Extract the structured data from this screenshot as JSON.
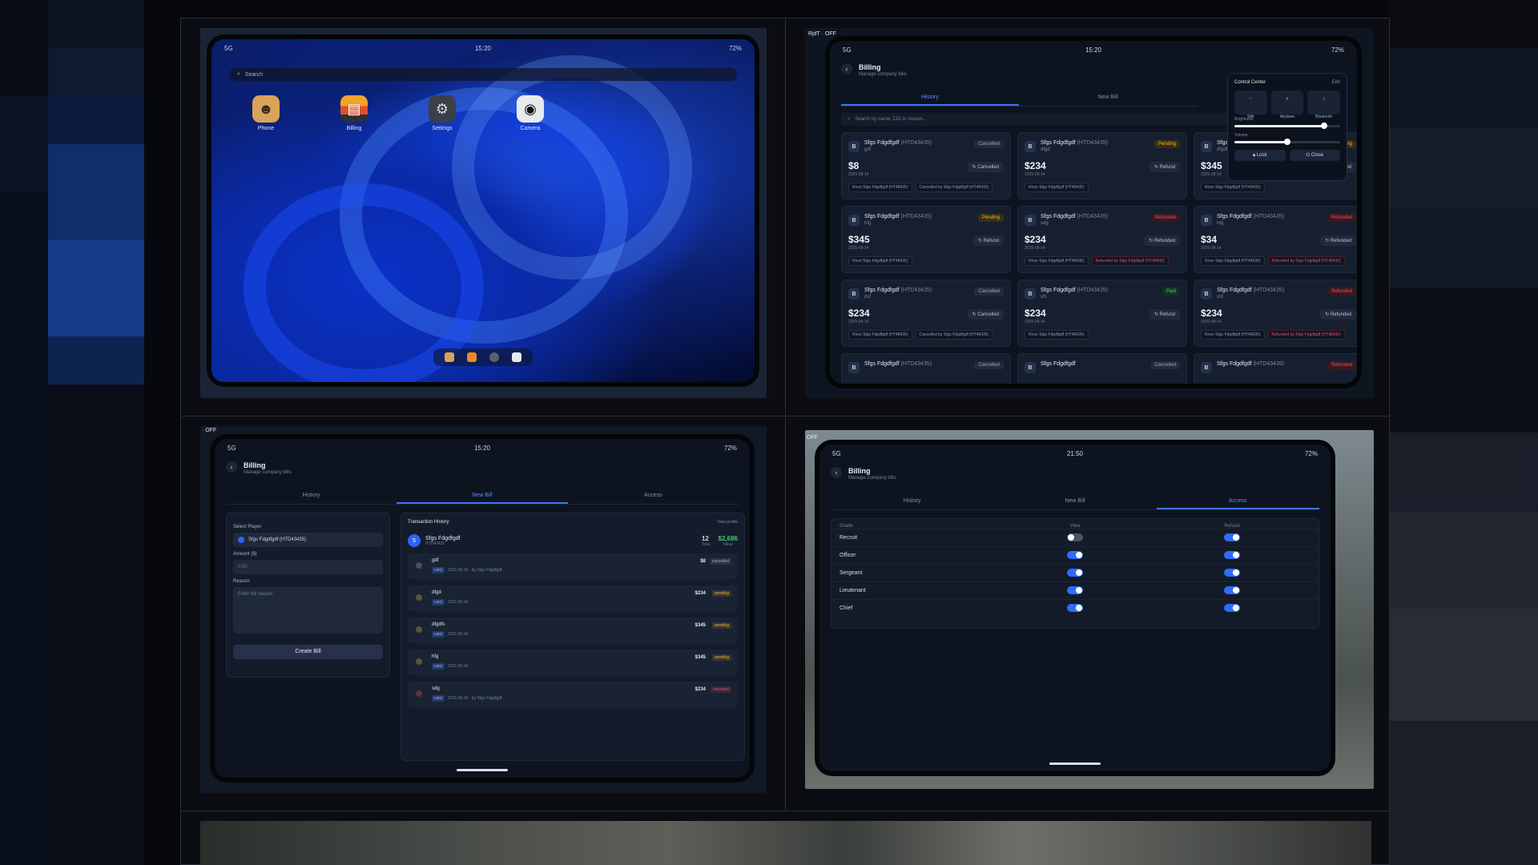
{
  "panel1": {
    "status": {
      "left": "5G",
      "time": "15:20",
      "right": "72%"
    },
    "search_placeholder": "Search",
    "apps": [
      {
        "label": "Phone",
        "icon": "person-icon"
      },
      {
        "label": "Billing",
        "icon": "wallet-icon"
      },
      {
        "label": "Settings",
        "icon": "gear-icon"
      },
      {
        "label": "Camera",
        "icon": "camera-icon"
      }
    ]
  },
  "panel2": {
    "corner_label": "RjdT · OFF",
    "status": {
      "left": "5G",
      "time": "15:20",
      "right": "72%"
    },
    "title": "Billing",
    "subtitle": "Manage company bills",
    "tabs": [
      "History",
      "New Bill"
    ],
    "search_placeholder": "Search by name, CID or reason...",
    "control_center": {
      "title": "Control Center",
      "edit": "Edit",
      "toggles": [
        "Wifi",
        "Airplane",
        "Bluetooth"
      ],
      "brightness_label": "Brightness",
      "brightness": 0.85,
      "volume_label": "Volume",
      "volume": 0.5,
      "lock": "Lock",
      "close": "Close"
    },
    "cards": [
      {
        "name": "Sfgs Fdgdfgdf",
        "cid": "(HTD43435)",
        "reason": "gdf",
        "status": "Cancelled",
        "st": "c",
        "amount": "$8",
        "date": "2025-08-14",
        "action": "Cancelled",
        "chips": [
          "Khun Sfgs Fdgdfgdf (HT48435)",
          "Cancelled by Sfgs Fdgdfgdf (HT48435)"
        ]
      },
      {
        "name": "Sfgs Fdgdfgdf",
        "cid": "(HTD43435)",
        "reason": "dfgd",
        "status": "Pending",
        "st": "p",
        "amount": "$234",
        "date": "2025-08-14",
        "action": "Refund",
        "chips": [
          "Khun Sfgs Fdgdfgdf (HT48435)"
        ]
      },
      {
        "name": "Sfgs Fdgdfgdf",
        "cid": "(HTD43435)",
        "reason": "dfgdfs",
        "status": "Pending",
        "st": "p",
        "amount": "$345",
        "date": "2025-08-14",
        "action": "Refund",
        "chips": [
          "Khun Sfgs Fdgdfgdf (HT48435)"
        ]
      },
      {
        "name": "Sfgs Fdgdfgdf",
        "cid": "(HTD43435)",
        "reason": "hfg",
        "status": "Pending",
        "st": "p",
        "amount": "$345",
        "date": "2025-08-14",
        "action": "Refund",
        "chips": [
          "Khun Sfgs Fdgdfgdf (HT48435)"
        ]
      },
      {
        "name": "Sfgs Fdgdfgdf",
        "cid": "(HTD43435)",
        "reason": "sdg",
        "status": "Refunded",
        "st": "r",
        "amount": "$234",
        "date": "2025-08-14",
        "action": "Refunded",
        "chips": [
          "Khun Sfgs Fdgdfgdf (HT48435)",
          "Refunded by Sfgs Fdgdfgdf (HT48435)"
        ]
      },
      {
        "name": "Sfgs Fdgdfgdf",
        "cid": "(HTD43435)",
        "reason": "hfg",
        "status": "Refunded",
        "st": "r",
        "amount": "$34",
        "date": "2025-08-14",
        "action": "Refunded",
        "chips": [
          "Khun Sfgs Fdgdfgdf (HT48435)",
          "Refunded by Sfgs Fdgdfgdf (HT48435)"
        ]
      },
      {
        "name": "Sfgs Fdgdfgdf",
        "cid": "(HTD43435)",
        "reason": "dsf",
        "status": "Cancelled",
        "st": "c",
        "amount": "$234",
        "date": "2025-08-14",
        "action": "Cancelled",
        "chips": [
          "Khun Sfgs Fdgdfgdf (HT48435)",
          "Cancelled by Sfgs Fdgdfgdf (HT48435)"
        ]
      },
      {
        "name": "Sfgs Fdgdfgdf",
        "cid": "(HTD43435)",
        "reason": "sfs",
        "status": "Paid",
        "st": "pd",
        "amount": "$234",
        "date": "2025-08-14",
        "action": "Refund",
        "chips": [
          "Khun Sfgs Fdgdfgdf (HT48435)"
        ]
      },
      {
        "name": "Sfgs Fdgdfgdf",
        "cid": "(HTD43435)",
        "reason": "sfd",
        "status": "Refunded",
        "st": "r",
        "amount": "$234",
        "date": "2025-08-14",
        "action": "Refunded",
        "chips": [
          "Khun Sfgs Fdgdfgdf (HT48435)",
          "Refunded by Sfgs Fdgdfgdf (HT48435)"
        ]
      },
      {
        "name": "Sfgs Fdgdfgdf",
        "cid": "(HTD43435)",
        "status": "Cancelled",
        "st": "c"
      },
      {
        "name": "Sfgs Fdgdfgdf",
        "cid": "",
        "status": "Cancelled",
        "st": "c"
      },
      {
        "name": "Sfgs Fdgdfgdf",
        "cid": "(HTD43435)",
        "status": "Refunded",
        "st": "r"
      }
    ]
  },
  "panel3": {
    "corner_label": "· OFF",
    "status": {
      "left": "5G",
      "time": "15:20",
      "right": "72%"
    },
    "title": "Billing",
    "subtitle": "Manage company bills",
    "tabs": [
      "History",
      "New Bill",
      "Access"
    ],
    "select_player_label": "Select Player",
    "selected_player": "Sfgs Fdgdfgdf (HTD43435)",
    "amount_label": "Amount ($)",
    "amount_placeholder": "0.00",
    "reason_label": "Reason",
    "reason_placeholder": "Enter bill reason",
    "create_button": "Create Bill",
    "tx_title": "Transaction History",
    "tx_link": "View profile",
    "tx_name": "Sfgs Fdgdfgdf",
    "tx_cid": "HTD43435",
    "tx_count": "12",
    "tx_count_label": "Total",
    "tx_value": "$2,686",
    "tx_value_label": "Value",
    "rows": [
      {
        "name": "gdf",
        "meta": "2025-08-14 · by Sfgs Fdgdfgdf",
        "amount": "$8",
        "status": "cancelled",
        "color": "#9aa7bd"
      },
      {
        "name": "dfgd",
        "meta": "2025-08-14",
        "amount": "$234",
        "status": "pending",
        "color": "#f2b531"
      },
      {
        "name": "dfgdfs",
        "meta": "2025-08-14",
        "amount": "$345",
        "status": "pending",
        "color": "#f2b531"
      },
      {
        "name": "hfg",
        "meta": "2025-08-14",
        "amount": "$345",
        "status": "pending",
        "color": "#f2b531"
      },
      {
        "name": "sdg",
        "meta": "2025-08-14 · by Sfgs Fdgdfgdf",
        "amount": "$234",
        "status": "refunded",
        "color": "#ef4d5e"
      }
    ],
    "row_tag": "card"
  },
  "panel4": {
    "corner_label": "OFF",
    "status": {
      "left": "5G",
      "time": "21:50",
      "right": "72%"
    },
    "title": "Billing",
    "subtitle": "Manage company bills",
    "tabs": [
      "History",
      "New Bill",
      "Access"
    ],
    "columns": [
      "Grade",
      "View",
      "Refund"
    ],
    "grades": [
      {
        "name": "Recruit",
        "view": false,
        "refund": true
      },
      {
        "name": "Officer",
        "view": true,
        "refund": true
      },
      {
        "name": "Sergeant",
        "view": true,
        "refund": true
      },
      {
        "name": "Lieutenant",
        "view": true,
        "refund": true
      },
      {
        "name": "Chief",
        "view": true,
        "refund": true
      }
    ]
  }
}
